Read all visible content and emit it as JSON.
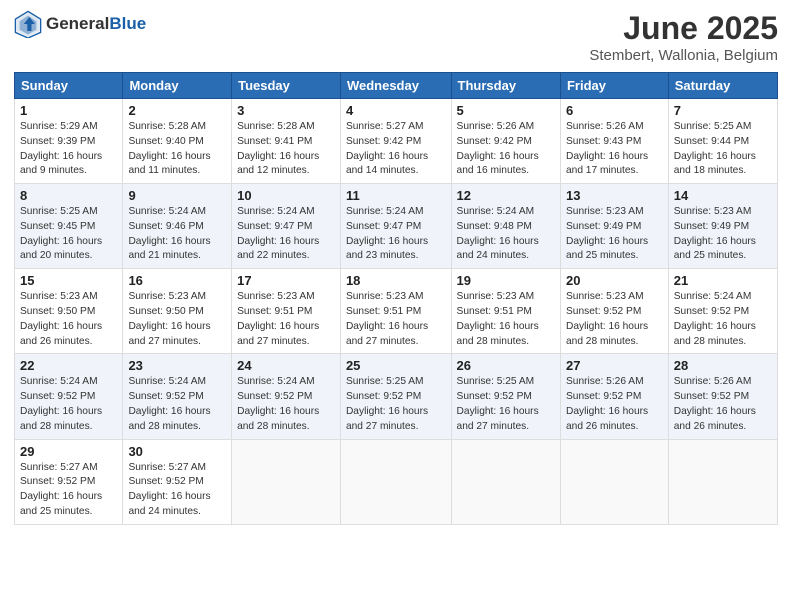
{
  "header": {
    "logo": {
      "general": "General",
      "blue": "Blue"
    },
    "title": "June 2025",
    "location": "Stembert, Wallonia, Belgium"
  },
  "calendar": {
    "days_of_week": [
      "Sunday",
      "Monday",
      "Tuesday",
      "Wednesday",
      "Thursday",
      "Friday",
      "Saturday"
    ],
    "weeks": [
      [
        {
          "day": "",
          "info": ""
        },
        {
          "day": "2",
          "info": "Sunrise: 5:28 AM\nSunset: 9:40 PM\nDaylight: 16 hours\nand 11 minutes."
        },
        {
          "day": "3",
          "info": "Sunrise: 5:28 AM\nSunset: 9:41 PM\nDaylight: 16 hours\nand 12 minutes."
        },
        {
          "day": "4",
          "info": "Sunrise: 5:27 AM\nSunset: 9:42 PM\nDaylight: 16 hours\nand 14 minutes."
        },
        {
          "day": "5",
          "info": "Sunrise: 5:26 AM\nSunset: 9:42 PM\nDaylight: 16 hours\nand 16 minutes."
        },
        {
          "day": "6",
          "info": "Sunrise: 5:26 AM\nSunset: 9:43 PM\nDaylight: 16 hours\nand 17 minutes."
        },
        {
          "day": "7",
          "info": "Sunrise: 5:25 AM\nSunset: 9:44 PM\nDaylight: 16 hours\nand 18 minutes."
        }
      ],
      [
        {
          "day": "1",
          "info": "Sunrise: 5:29 AM\nSunset: 9:39 PM\nDaylight: 16 hours\nand 9 minutes."
        },
        {
          "day": "9",
          "info": "Sunrise: 5:24 AM\nSunset: 9:46 PM\nDaylight: 16 hours\nand 21 minutes."
        },
        {
          "day": "10",
          "info": "Sunrise: 5:24 AM\nSunset: 9:47 PM\nDaylight: 16 hours\nand 22 minutes."
        },
        {
          "day": "11",
          "info": "Sunrise: 5:24 AM\nSunset: 9:47 PM\nDaylight: 16 hours\nand 23 minutes."
        },
        {
          "day": "12",
          "info": "Sunrise: 5:24 AM\nSunset: 9:48 PM\nDaylight: 16 hours\nand 24 minutes."
        },
        {
          "day": "13",
          "info": "Sunrise: 5:23 AM\nSunset: 9:49 PM\nDaylight: 16 hours\nand 25 minutes."
        },
        {
          "day": "14",
          "info": "Sunrise: 5:23 AM\nSunset: 9:49 PM\nDaylight: 16 hours\nand 25 minutes."
        }
      ],
      [
        {
          "day": "8",
          "info": "Sunrise: 5:25 AM\nSunset: 9:45 PM\nDaylight: 16 hours\nand 20 minutes."
        },
        {
          "day": "16",
          "info": "Sunrise: 5:23 AM\nSunset: 9:50 PM\nDaylight: 16 hours\nand 27 minutes."
        },
        {
          "day": "17",
          "info": "Sunrise: 5:23 AM\nSunset: 9:51 PM\nDaylight: 16 hours\nand 27 minutes."
        },
        {
          "day": "18",
          "info": "Sunrise: 5:23 AM\nSunset: 9:51 PM\nDaylight: 16 hours\nand 27 minutes."
        },
        {
          "day": "19",
          "info": "Sunrise: 5:23 AM\nSunset: 9:51 PM\nDaylight: 16 hours\nand 28 minutes."
        },
        {
          "day": "20",
          "info": "Sunrise: 5:23 AM\nSunset: 9:52 PM\nDaylight: 16 hours\nand 28 minutes."
        },
        {
          "day": "21",
          "info": "Sunrise: 5:24 AM\nSunset: 9:52 PM\nDaylight: 16 hours\nand 28 minutes."
        }
      ],
      [
        {
          "day": "15",
          "info": "Sunrise: 5:23 AM\nSunset: 9:50 PM\nDaylight: 16 hours\nand 26 minutes."
        },
        {
          "day": "23",
          "info": "Sunrise: 5:24 AM\nSunset: 9:52 PM\nDaylight: 16 hours\nand 28 minutes."
        },
        {
          "day": "24",
          "info": "Sunrise: 5:24 AM\nSunset: 9:52 PM\nDaylight: 16 hours\nand 28 minutes."
        },
        {
          "day": "25",
          "info": "Sunrise: 5:25 AM\nSunset: 9:52 PM\nDaylight: 16 hours\nand 27 minutes."
        },
        {
          "day": "26",
          "info": "Sunrise: 5:25 AM\nSunset: 9:52 PM\nDaylight: 16 hours\nand 27 minutes."
        },
        {
          "day": "27",
          "info": "Sunrise: 5:26 AM\nSunset: 9:52 PM\nDaylight: 16 hours\nand 26 minutes."
        },
        {
          "day": "28",
          "info": "Sunrise: 5:26 AM\nSunset: 9:52 PM\nDaylight: 16 hours\nand 26 minutes."
        }
      ],
      [
        {
          "day": "22",
          "info": "Sunrise: 5:24 AM\nSunset: 9:52 PM\nDaylight: 16 hours\nand 28 minutes."
        },
        {
          "day": "30",
          "info": "Sunrise: 5:27 AM\nSunset: 9:52 PM\nDaylight: 16 hours\nand 24 minutes."
        },
        {
          "day": "",
          "info": ""
        },
        {
          "day": "",
          "info": ""
        },
        {
          "day": "",
          "info": ""
        },
        {
          "day": "",
          "info": ""
        },
        {
          "day": ""
        }
      ],
      [
        {
          "day": "29",
          "info": "Sunrise: 5:27 AM\nSunset: 9:52 PM\nDaylight: 16 hours\nand 25 minutes."
        },
        {
          "day": "",
          "info": ""
        },
        {
          "day": "",
          "info": ""
        },
        {
          "day": "",
          "info": ""
        },
        {
          "day": "",
          "info": ""
        },
        {
          "day": "",
          "info": ""
        },
        {
          "day": "",
          "info": ""
        }
      ]
    ]
  }
}
